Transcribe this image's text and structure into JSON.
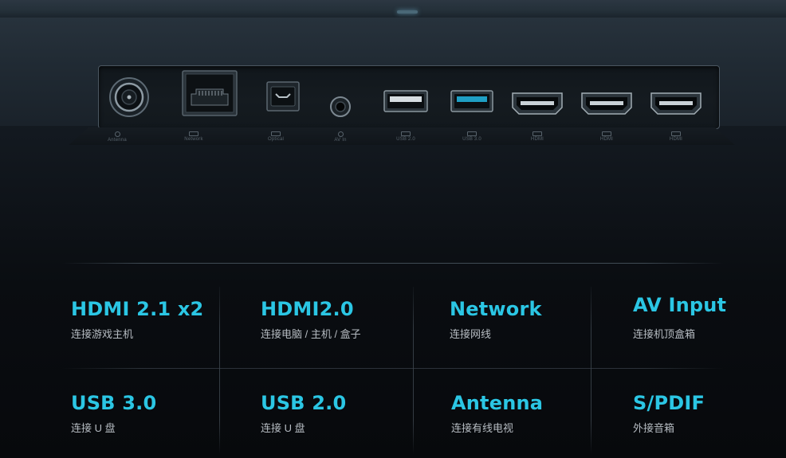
{
  "ports": {
    "labels": [
      "Antenna",
      "Network",
      "Optical",
      "AV In",
      "USB 2.0",
      "USB 3.0",
      "HDMI",
      "HDMI",
      "HDMI"
    ]
  },
  "specs": [
    {
      "title": "HDMI 2.1 x2",
      "subtitle": "连接游戏主机"
    },
    {
      "title": "HDMI2.0",
      "subtitle": "连接电脑 / 主机 / 盒子"
    },
    {
      "title": "Network",
      "subtitle": "连接网线"
    },
    {
      "title": "AV Input",
      "subtitle": "连接机顶盒箱"
    },
    {
      "title": "USB 3.0",
      "subtitle": "连接 U 盘"
    },
    {
      "title": "USB 2.0",
      "subtitle": "连接 U 盘"
    },
    {
      "title": "Antenna",
      "subtitle": "连接有线电视"
    },
    {
      "title": "S/PDIF",
      "subtitle": "外接音箱"
    }
  ],
  "colors": {
    "accent": "#2bc6e4",
    "subtitle": "#b6bcc2",
    "usb3_highlight": "#1f9fc4",
    "background": "#07090c"
  }
}
